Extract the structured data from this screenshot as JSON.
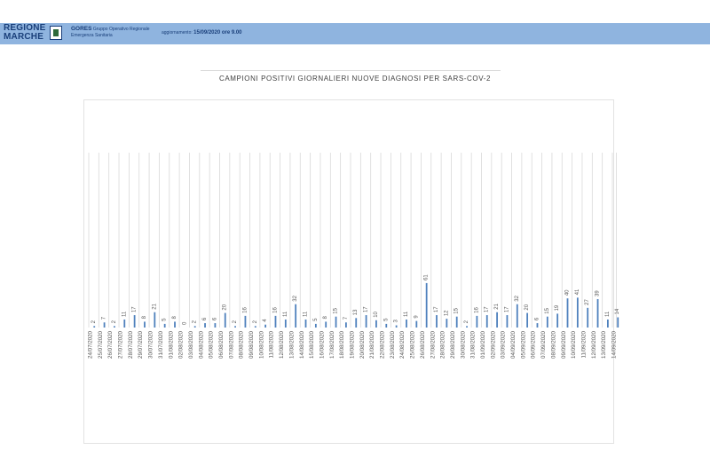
{
  "header": {
    "logo_text_line1": "REGIONE",
    "logo_text_line2": "MARCHE",
    "gores_name": "GORES",
    "gores_line1": "Gruppo Operativo Regionale",
    "gores_line2": "Emergenza Sanitaria",
    "update_label": "aggiornamento:",
    "update_value": "15/09/2020 ore 9.00"
  },
  "colors": {
    "header_bg": "#8fb4df",
    "bar": "#4f81bd",
    "grid": "#d9d9d9"
  },
  "chart_data": {
    "type": "bar",
    "title": "CAMPIONI POSITIVI GIORNALIERI NUOVE DIAGNOSI PER SARS-COV-2",
    "xlabel": "",
    "ylabel": "",
    "ylim": [
      0,
      240
    ],
    "grid": true,
    "legend": "none",
    "data_labels": true,
    "categories": [
      "24/07/2020",
      "25/07/2020",
      "26/07/2020",
      "27/07/2020",
      "28/07/2020",
      "29/07/2020",
      "30/07/2020",
      "31/07/2020",
      "01/08/2020",
      "02/08/2020",
      "03/08/2020",
      "04/08/2020",
      "05/08/2020",
      "06/08/2020",
      "07/08/2020",
      "08/08/2020",
      "09/08/2020",
      "10/08/2020",
      "11/08/2020",
      "12/08/2020",
      "13/08/2020",
      "14/08/2020",
      "15/08/2020",
      "16/08/2020",
      "17/08/2020",
      "18/08/2020",
      "19/08/2020",
      "20/08/2020",
      "21/08/2020",
      "22/08/2020",
      "23/08/2020",
      "24/08/2020",
      "25/08/2020",
      "26/08/2020",
      "27/08/2020",
      "28/08/2020",
      "29/08/2020",
      "30/08/2020",
      "31/08/2020",
      "01/09/2020",
      "02/09/2020",
      "03/09/2020",
      "04/09/2020",
      "05/09/2020",
      "06/09/2020",
      "07/09/2020",
      "08/09/2020",
      "09/09/2020",
      "10/09/2020",
      "11/09/2020",
      "12/09/2020",
      "13/09/2020",
      "14/09/2020"
    ],
    "values": [
      2,
      7,
      2,
      11,
      17,
      8,
      21,
      5,
      8,
      0,
      2,
      6,
      6,
      20,
      2,
      16,
      2,
      4,
      16,
      11,
      32,
      11,
      5,
      8,
      15,
      7,
      13,
      17,
      10,
      5,
      3,
      11,
      9,
      61,
      17,
      12,
      15,
      2,
      16,
      17,
      21,
      17,
      32,
      20,
      6,
      15,
      19,
      40,
      41,
      27,
      39,
      11,
      14
    ]
  }
}
